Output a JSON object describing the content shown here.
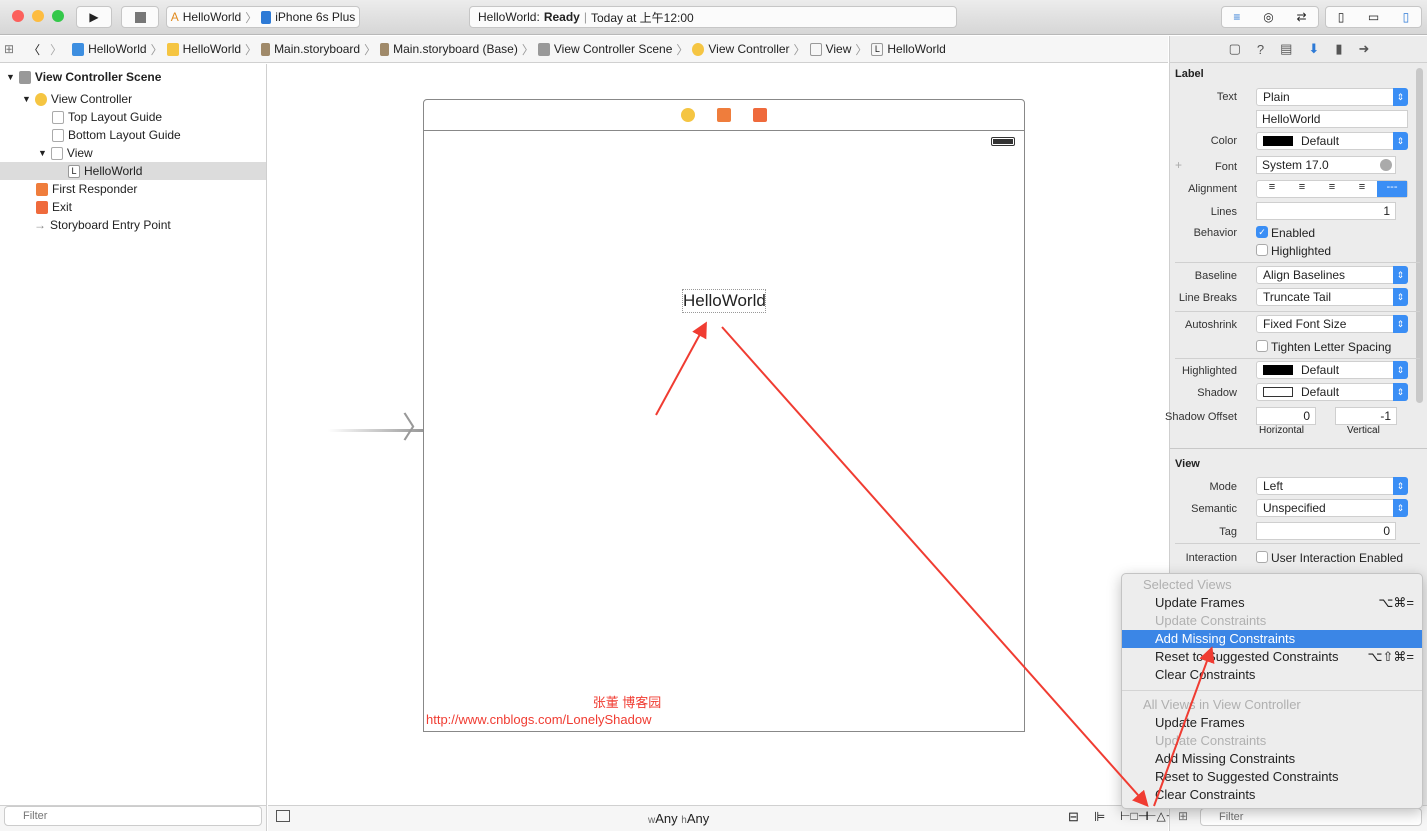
{
  "toolbar": {
    "scheme": "HelloWorld",
    "device": "iPhone 6s Plus",
    "status_app": "HelloWorld:",
    "status_state": "Ready",
    "status_time": "Today at 上午12:00"
  },
  "breadcrumb": [
    "HelloWorld",
    "HelloWorld",
    "Main.storyboard",
    "Main.storyboard (Base)",
    "View Controller Scene",
    "View Controller",
    "View",
    "HelloWorld"
  ],
  "outline": {
    "items": [
      {
        "label": "View Controller Scene"
      },
      {
        "label": "View Controller"
      },
      {
        "label": "Top Layout Guide"
      },
      {
        "label": "Bottom Layout Guide"
      },
      {
        "label": "View"
      },
      {
        "label": "HelloWorld"
      },
      {
        "label": "First Responder"
      },
      {
        "label": "Exit"
      },
      {
        "label": "Storyboard Entry Point"
      }
    ],
    "filter_placeholder": "Filter"
  },
  "canvas": {
    "label_text": "HelloWorld",
    "watermark_name": "张董 博客园",
    "watermark_url": "http://www.cnblogs.com/LonelyShadow",
    "size_class_w": "w",
    "size_class_w_val": "Any",
    "size_class_h": "h",
    "size_class_h_val": "Any"
  },
  "inspector": {
    "label_section": "Label",
    "text_label": "Text",
    "text_value": "Plain",
    "text_content": "HelloWorld",
    "color_label": "Color",
    "color_value": "Default",
    "font_label": "Font",
    "font_value": "System 17.0",
    "alignment_label": "Alignment",
    "lines_label": "Lines",
    "lines_value": "1",
    "behavior_label": "Behavior",
    "enabled": "Enabled",
    "highlighted": "Highlighted",
    "baseline_label": "Baseline",
    "baseline_value": "Align Baselines",
    "linebreaks_label": "Line Breaks",
    "linebreaks_value": "Truncate Tail",
    "autoshrink_label": "Autoshrink",
    "autoshrink_value": "Fixed Font Size",
    "tighten": "Tighten Letter Spacing",
    "hl_label": "Highlighted",
    "hl_value": "Default",
    "shadow_label": "Shadow",
    "shadow_value": "Default",
    "shadow_offset_label": "Shadow Offset",
    "offset_h": "0",
    "offset_v": "-1",
    "horizontal": "Horizontal",
    "vertical": "Vertical",
    "view_section": "View",
    "mode_label": "Mode",
    "mode_value": "Left",
    "semantic_label": "Semantic",
    "semantic_value": "Unspecified",
    "tag_label": "Tag",
    "tag_value": "0",
    "interaction_label": "Interaction",
    "user_interaction": "User Interaction Enabled",
    "filter_placeholder": "Filter"
  },
  "menu": {
    "sec1": "Selected Views",
    "items1": [
      {
        "label": "Update Frames",
        "shortcut": "⌥⌘="
      },
      {
        "label": "Update Constraints"
      },
      {
        "label": "Add Missing Constraints"
      },
      {
        "label": "Reset to Suggested Constraints",
        "shortcut": "⌥⇧⌘="
      },
      {
        "label": "Clear Constraints"
      }
    ],
    "sec2": "All Views in View Controller",
    "items2": [
      {
        "label": "Update Frames"
      },
      {
        "label": "Update Constraints"
      },
      {
        "label": "Add Missing Constraints"
      },
      {
        "label": "Reset to Suggested Constraints"
      },
      {
        "label": "Clear Constraints"
      }
    ]
  },
  "colors": {
    "accent": "#3b86e6",
    "annotation": "#f03c32"
  }
}
